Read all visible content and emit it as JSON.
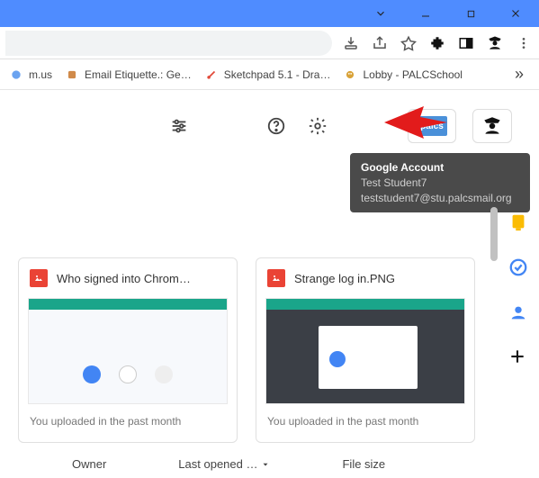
{
  "window": {
    "controls": [
      "chevron-down",
      "minimize",
      "maximize",
      "close"
    ]
  },
  "addressbar": {
    "icons": [
      "install-icon",
      "share-icon",
      "star-icon",
      "extensions-icon",
      "sidepanel-icon",
      "profile-icon",
      "menu-icon"
    ]
  },
  "bookmarks": {
    "items": [
      {
        "label": "m.us",
        "color": "#6aa3f0"
      },
      {
        "label": "Email Etiquette.: Ge…",
        "color": "#d08a4a"
      },
      {
        "label": "Sketchpad 5.1 - Dra…",
        "color": "#e24a3a"
      },
      {
        "label": "Lobby - PALCSchool",
        "color": "#d9a33a"
      }
    ],
    "overflow": "»"
  },
  "drive": {
    "org_label": "palcs",
    "tooltip": {
      "title": "Google Account",
      "name": "Test Student7",
      "email": "teststudent7@stu.palcsmail.org"
    },
    "cards": [
      {
        "title": "Who signed into Chrom…",
        "subtitle": "You uploaded in the past month"
      },
      {
        "title": "Strange log in.PNG",
        "subtitle": "You uploaded in the past month"
      }
    ],
    "columns": {
      "owner": "Owner",
      "sort": "Last opened …",
      "size": "File size"
    }
  }
}
